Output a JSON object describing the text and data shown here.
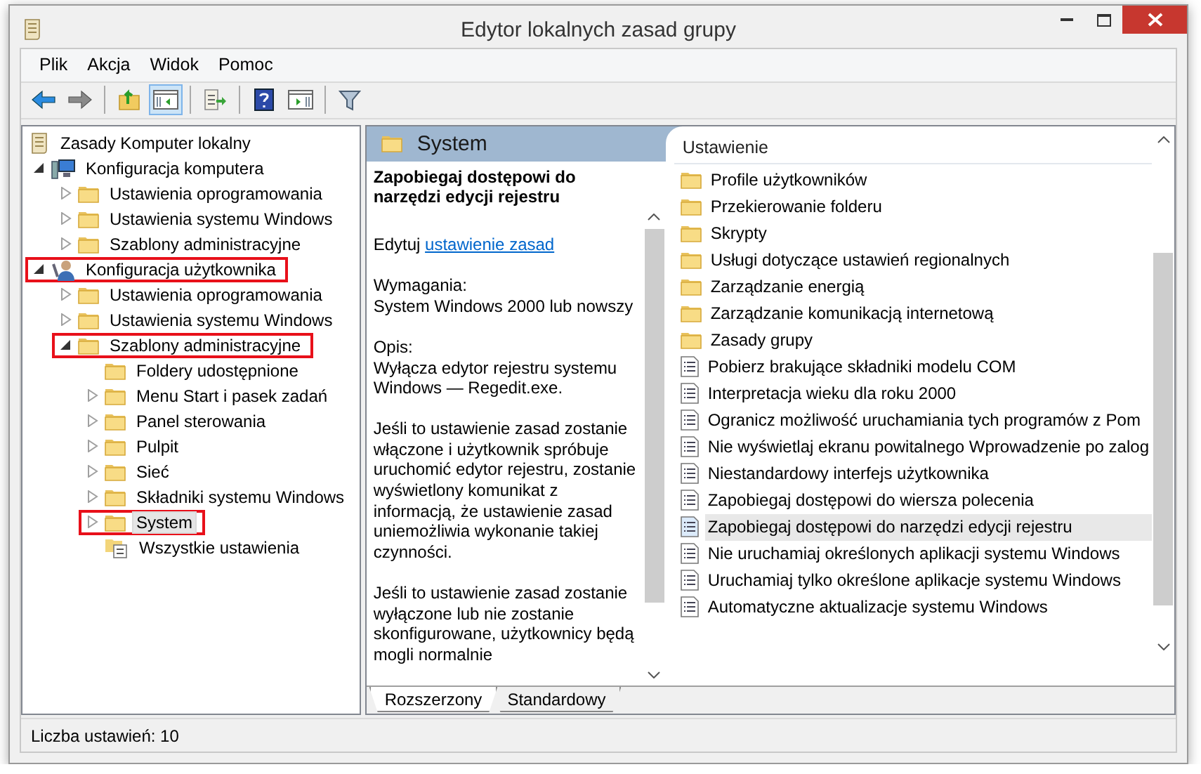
{
  "window": {
    "title": "Edytor lokalnych zasad grupy"
  },
  "menu": [
    "Plik",
    "Akcja",
    "Widok",
    "Pomoc"
  ],
  "toolbar": [
    {
      "kind": "back",
      "pressed": false
    },
    {
      "kind": "forward",
      "pressed": false
    },
    {
      "kind": "separator"
    },
    {
      "kind": "up",
      "pressed": false
    },
    {
      "kind": "tree",
      "pressed": true
    },
    {
      "kind": "separator"
    },
    {
      "kind": "export",
      "pressed": false
    },
    {
      "kind": "separator"
    },
    {
      "kind": "help",
      "pressed": false
    },
    {
      "kind": "pane",
      "pressed": false
    },
    {
      "kind": "separator"
    },
    {
      "kind": "filter",
      "pressed": false
    }
  ],
  "tree": [
    {
      "label": "Zasady Komputer lokalny",
      "kind": "policy",
      "highlighted": false,
      "selected": false,
      "children": [
        {
          "label": "Konfiguracja komputera",
          "kind": "computer",
          "expanded": true,
          "highlighted": false,
          "selected": false,
          "children": [
            {
              "label": "Ustawienia oprogramowania",
              "kind": "folder",
              "expanded": false,
              "highlighted": false,
              "selected": false
            },
            {
              "label": "Ustawienia systemu Windows",
              "kind": "folder",
              "expanded": false,
              "highlighted": false,
              "selected": false
            },
            {
              "label": "Szablony administracyjne",
              "kind": "folder",
              "expanded": false,
              "highlighted": false,
              "selected": false
            }
          ]
        },
        {
          "label": "Konfiguracja użytkownika",
          "kind": "user",
          "expanded": true,
          "highlighted": true,
          "selected": false,
          "children": [
            {
              "label": "Ustawienia oprogramowania",
              "kind": "folder",
              "expanded": false,
              "highlighted": false,
              "selected": false
            },
            {
              "label": "Ustawienia systemu Windows",
              "kind": "folder",
              "expanded": false,
              "highlighted": false,
              "selected": false
            },
            {
              "label": "Szablony administracyjne",
              "kind": "folder",
              "expanded": true,
              "highlighted": true,
              "selected": false,
              "children": [
                {
                  "label": "Foldery udostępnione",
                  "kind": "folder",
                  "highlighted": false,
                  "selected": false
                },
                {
                  "label": "Menu Start i pasek zadań",
                  "kind": "folder",
                  "expanded": false,
                  "highlighted": false,
                  "selected": false
                },
                {
                  "label": "Panel sterowania",
                  "kind": "folder",
                  "expanded": false,
                  "highlighted": false,
                  "selected": false
                },
                {
                  "label": "Pulpit",
                  "kind": "folder",
                  "expanded": false,
                  "highlighted": false,
                  "selected": false
                },
                {
                  "label": "Sieć",
                  "kind": "folder",
                  "expanded": false,
                  "highlighted": false,
                  "selected": false
                },
                {
                  "label": "Składniki systemu Windows",
                  "kind": "folder",
                  "expanded": false,
                  "highlighted": false,
                  "selected": false
                },
                {
                  "label": "System",
                  "kind": "folder",
                  "expanded": false,
                  "highlighted": true,
                  "selected": true
                },
                {
                  "label": "Wszystkie ustawienia",
                  "kind": "all",
                  "highlighted": false,
                  "selected": false
                }
              ]
            }
          ]
        }
      ]
    }
  ],
  "pane": {
    "title": "System"
  },
  "details": {
    "title": "Zapobiegaj dostępowi do narzędzi edycji rejestru",
    "edit_prefix": "Edytuj",
    "edit_link": "ustawienie zasad",
    "requirements_label": "Wymagania:",
    "requirements": "System Windows 2000 lub nowszy",
    "description_label": "Opis:",
    "description": "Wyłącza edytor rejestru systemu Windows — Regedit.exe.",
    "paragraphs": [
      "Jeśli to ustawienie zasad zostanie włączone i użytkownik spróbuje uruchomić edytor rejestru, zostanie wyświetlony komunikat z informacją, że ustawienie zasad uniemożliwia wykonanie takiej czynności.",
      "Jeśli to ustawienie zasad zostanie wyłączone lub nie zostanie skonfigurowane, użytkownicy będą mogli normalnie"
    ]
  },
  "list": {
    "column": "Ustawienie",
    "rows": [
      {
        "label": "Profile użytkowników",
        "kind": "folder",
        "selected": false
      },
      {
        "label": "Przekierowanie folderu",
        "kind": "folder",
        "selected": false
      },
      {
        "label": "Skrypty",
        "kind": "folder",
        "selected": false
      },
      {
        "label": "Usługi dotyczące ustawień regionalnych",
        "kind": "folder",
        "selected": false
      },
      {
        "label": "Zarządzanie energią",
        "kind": "folder",
        "selected": false
      },
      {
        "label": "Zarządzanie komunikacją internetową",
        "kind": "folder",
        "selected": false
      },
      {
        "label": "Zasady grupy",
        "kind": "folder",
        "selected": false
      },
      {
        "label": "Pobierz brakujące składniki modelu COM",
        "kind": "setting",
        "selected": false
      },
      {
        "label": "Interpretacja wieku dla roku 2000",
        "kind": "setting",
        "selected": false
      },
      {
        "label": "Ogranicz możliwość uruchamiania tych programów z Pom",
        "kind": "setting",
        "selected": false
      },
      {
        "label": "Nie wyświetlaj ekranu powitalnego Wprowadzenie po zalog",
        "kind": "setting",
        "selected": false
      },
      {
        "label": "Niestandardowy interfejs użytkownika",
        "kind": "setting",
        "selected": false
      },
      {
        "label": "Zapobiegaj dostępowi do wiersza polecenia",
        "kind": "setting",
        "selected": false
      },
      {
        "label": "Zapobiegaj dostępowi do narzędzi edycji rejestru",
        "kind": "setting",
        "selected": true
      },
      {
        "label": "Nie uruchamiaj określonych aplikacji systemu Windows",
        "kind": "setting",
        "selected": false
      },
      {
        "label": "Uruchamiaj tylko określone aplikacje systemu Windows",
        "kind": "setting",
        "selected": false
      },
      {
        "label": "Automatyczne aktualizacje systemu Windows",
        "kind": "setting",
        "selected": false
      }
    ]
  },
  "view_tabs": [
    {
      "label": "Rozszerzony",
      "selected": true
    },
    {
      "label": "Standardowy",
      "selected": false
    }
  ],
  "status_bar": "Liczba ustawień: 10"
}
